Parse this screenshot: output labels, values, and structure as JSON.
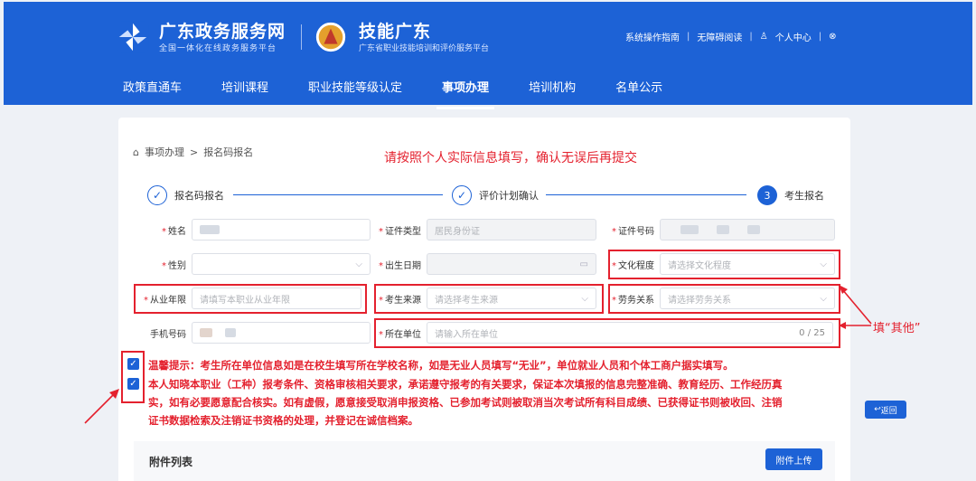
{
  "header": {
    "brand1_title": "广东政务服务网",
    "brand1_sub": "全国一体化在线政务服务平台",
    "brand2_title": "技能广东",
    "brand2_sub": "广东省职业技能培训和评价服务平台",
    "links": [
      "系统操作指南",
      "无障碍阅读",
      "个人中心",
      "⊗"
    ]
  },
  "nav": {
    "items": [
      "政策直通车",
      "培训课程",
      "职业技能等级认定",
      "事项办理",
      "培训机构",
      "名单公示"
    ],
    "active": "事项办理"
  },
  "breadcrumb": {
    "root": "事项办理",
    "sep": ">",
    "current": "报名码报名"
  },
  "notice": "请按照个人实际信息填写，确认无误后再提交",
  "steps": [
    {
      "label": "报名码报名",
      "mark": "✓"
    },
    {
      "label": "评价计划确认",
      "mark": "✓"
    },
    {
      "label": "考生报名",
      "mark": "3"
    }
  ],
  "form": {
    "name_label": "姓名",
    "id_type_label": "证件类型",
    "id_type_value": "居民身份证",
    "id_no_label": "证件号码",
    "gender_label": "性别",
    "birth_label": "出生日期",
    "edu_label": "文化程度",
    "edu_placeholder": "请选择文化程度",
    "years_label": "从业年限",
    "years_placeholder": "请填写本职业从业年限",
    "source_label": "考生来源",
    "source_placeholder": "请选择考生来源",
    "labor_label": "劳务关系",
    "labor_placeholder": "请选择劳务关系",
    "phone_label": "手机号码",
    "unit_label": "所在单位",
    "unit_placeholder": "请输入所在单位",
    "unit_count": "0 / 25"
  },
  "tips": {
    "line1": "温馨提示：考生所在单位信息如是在校生填写所在学校名称，如是无业人员填写“无业”，单位就业人员和个体工商户据实填写。",
    "line2": "本人知晓本职业（工种）报考条件、资格审核相关要求，承诺遵守报考的有关要求，保证本次填报的信息完整准确、教育经历、工作经历真",
    "line3": "实，如有必要愿意配合核实。如有虚假，愿意接受取消申报资格、已参加考试则被取消当次考试所有科目成绩、已获得证书则被收回、注销",
    "line4": "证书数据检索及注销证书资格的处理，并登记在诚信档案。"
  },
  "annotation": "填“其他”",
  "back_button": "返回",
  "attachments": {
    "title": "附件列表",
    "upload": "附件上传"
  },
  "colors": {
    "primary": "#1d62d6",
    "annotation_red": "#e4212e"
  }
}
